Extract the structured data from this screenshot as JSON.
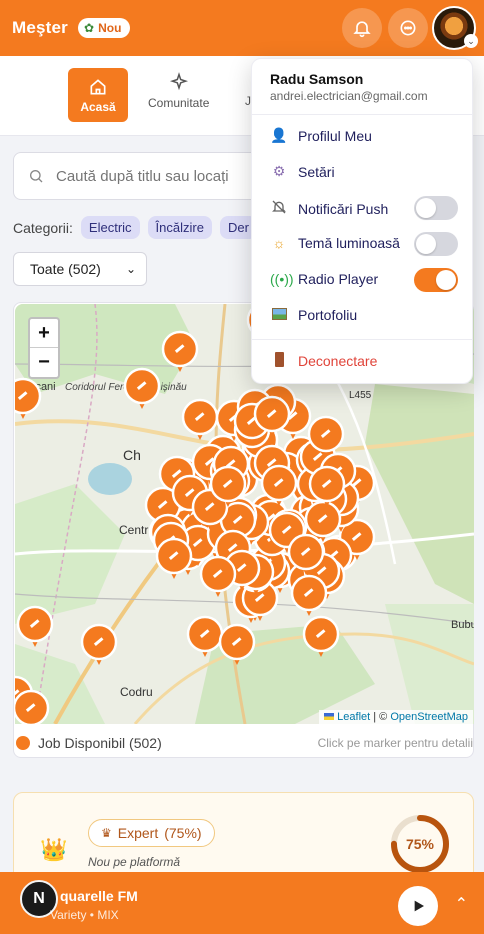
{
  "header": {
    "brand": "Meşter",
    "badge": "Nou",
    "colors": {
      "accent": "#f47a1f"
    }
  },
  "nav": {
    "tabs": [
      {
        "label": "Acasă",
        "icon": "home-icon",
        "active": true
      },
      {
        "label": "Comunitate",
        "icon": "sparkles-icon",
        "active": false
      },
      {
        "label": "J",
        "icon": "",
        "active": false
      }
    ]
  },
  "search": {
    "placeholder": "Caută după titlu sau locați"
  },
  "categories": {
    "label": "Categorii:",
    "items": [
      "Electric",
      "Încălzire",
      "Der"
    ]
  },
  "filter": {
    "selected": "Toate (502)"
  },
  "map": {
    "zoom_in": "+",
    "zoom_out": "−",
    "labels": [
      "Coridorul Feroviar Chișinău",
      "icani",
      "Ch",
      "Centr",
      "Codru",
      "L455",
      "Bubu"
    ],
    "attribution": {
      "leaflet": "Leaflet",
      "separator": "| ©",
      "osm": "OpenStreetMap"
    },
    "legend": "Job Disponibil (502)",
    "hint": "Click pe marker pentru detalii"
  },
  "user_menu": {
    "name": "Radu Samson",
    "email": "andrei.electrician@gmail.com",
    "items": [
      {
        "label": "Profilul Meu",
        "icon": "person-icon"
      },
      {
        "label": "Setări",
        "icon": "gear-icon"
      },
      {
        "label": "Notificări Push",
        "icon": "bell-off-icon",
        "toggle": false
      },
      {
        "label": "Temă luminoasă",
        "icon": "sun-icon",
        "toggle": false
      },
      {
        "label": "Radio Player",
        "icon": "radio-icon",
        "toggle": true
      },
      {
        "label": "Portofoliu",
        "icon": "image-icon"
      }
    ],
    "logout": "Deconectare"
  },
  "expert": {
    "level": "Expert",
    "percent_label": "(75%)",
    "subtitle": "Nou pe platformă",
    "progress": 75,
    "ring_label": "75%"
  },
  "player": {
    "station_initial": "N",
    "station": "quarelle FM",
    "subtitle": "Variety • MIX"
  }
}
